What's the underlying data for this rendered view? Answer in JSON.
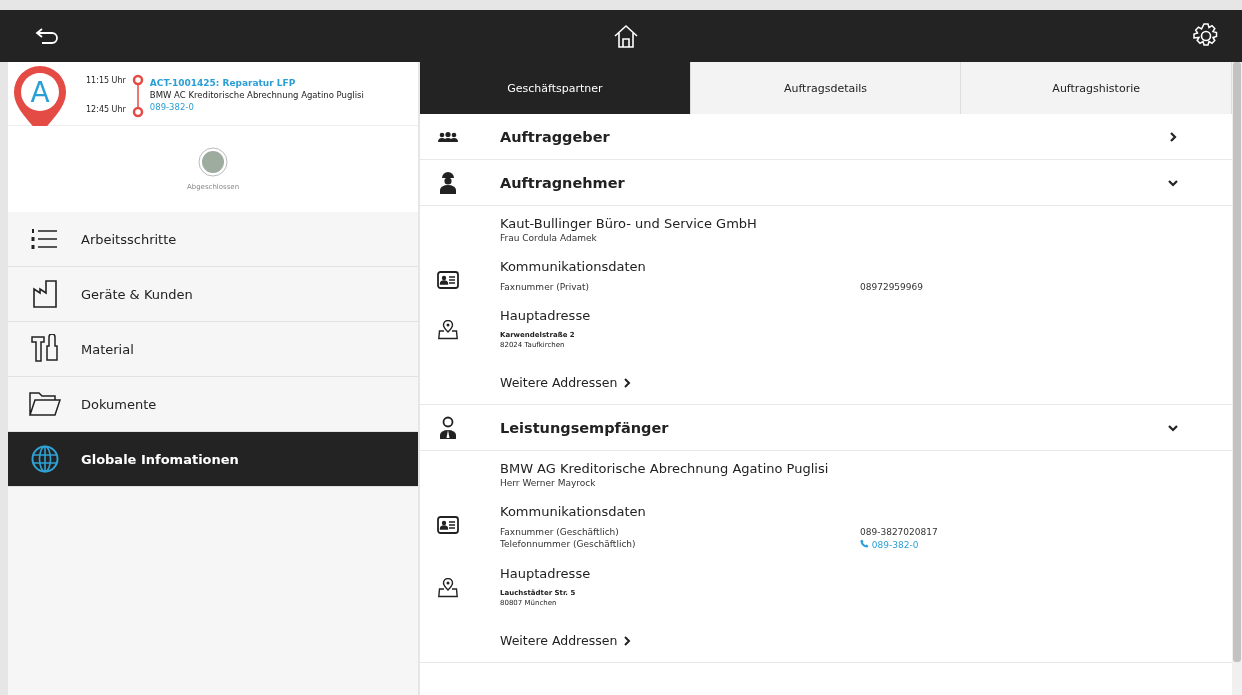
{
  "appointment": {
    "start_time": "11:15 Uhr",
    "end_time": "12:45 Uhr",
    "title": "ACT-1001425: Reparatur LFP",
    "customer": "BMW AC Kreditorische Abrechnung Agatino Puglisi",
    "phone": "089-382-0",
    "marker_letter": "A"
  },
  "status": {
    "label": "Abgeschlossen"
  },
  "nav": [
    {
      "label": "Arbeitsschritte",
      "kind": "list",
      "selected": false
    },
    {
      "label": "Geräte & Kunden",
      "kind": "factory",
      "selected": false
    },
    {
      "label": "Material",
      "kind": "tools",
      "selected": false
    },
    {
      "label": "Dokumente",
      "kind": "folder",
      "selected": false
    },
    {
      "label": "Globale Infomationen",
      "kind": "globe",
      "selected": true
    }
  ],
  "tabs": [
    {
      "label": "Geschäftspartner",
      "selected": true
    },
    {
      "label": "Auftragsdetails",
      "selected": false
    },
    {
      "label": "Auftragshistorie",
      "selected": false
    }
  ],
  "sections": [
    {
      "title": "Auftraggeber",
      "kind": "group",
      "expanded": false
    },
    {
      "title": "Auftragnehmer",
      "kind": "worker",
      "expanded": true,
      "company": "Kaut-Bullinger Büro- und Service GmbH",
      "contact": "Frau Cordula Adamek",
      "communication": {
        "title": "Kommunikationsdaten",
        "rows": [
          {
            "label": "Faxnummer (Privat)",
            "value": "08972959969",
            "kind": "text"
          }
        ]
      },
      "address": {
        "title": "Hauptadresse",
        "street": "Karwendelstraße 2",
        "city": "82024 Taufkirchen"
      },
      "more_link": "Weitere Addressen"
    },
    {
      "title": "Leistungsempfänger",
      "kind": "agent",
      "expanded": true,
      "company": "BMW AG Kreditorische Abrechnung Agatino Puglisi",
      "contact": "Herr Werner Mayrock",
      "communication": {
        "title": "Kommunikationsdaten",
        "rows": [
          {
            "label": "Faxnummer (Geschäftlich)",
            "value": "089-3827020817",
            "kind": "text"
          },
          {
            "label": "Telefonnummer (Geschäftlich)",
            "value": "089-382-0",
            "kind": "phone"
          }
        ]
      },
      "address": {
        "title": "Hauptadresse",
        "street": "Lauchstädter Str. 5",
        "city": "80807 München"
      },
      "more_link": "Weitere Addressen"
    }
  ]
}
